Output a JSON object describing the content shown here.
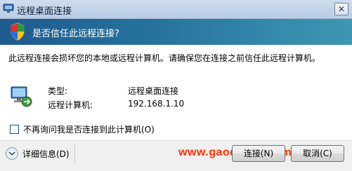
{
  "window": {
    "title": "远程桌面连接",
    "close_glyph": "✕"
  },
  "banner": {
    "question": "是否信任此远程连接?"
  },
  "message": {
    "warning": "此远程连接会损坏您的本地或远程计算机。请确保您在连接之前信任此远程计算机。"
  },
  "connection": {
    "type_label": "类型:",
    "type_value": "远程桌面连接",
    "computer_label": "远程计算机:",
    "computer_value": "192.168.1.10"
  },
  "options": {
    "dont_ask_label": "不再询问我是否连接到此计算机(O)",
    "dont_ask_checked": false
  },
  "footer": {
    "details_label": "详细信息(D)",
    "connect_label": "连接(N)",
    "cancel_label": "取消(C)"
  },
  "watermark": {
    "text": "www.gaodaima.com"
  },
  "colors": {
    "banner_start": "#1e5a8e",
    "banner_end": "#3e97b3",
    "watermark": "#ff3300"
  }
}
